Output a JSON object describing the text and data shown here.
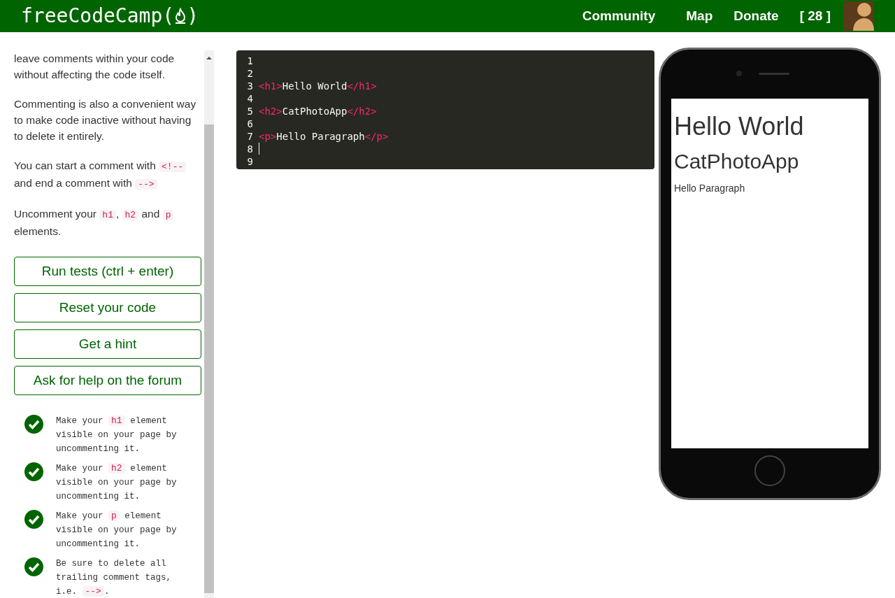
{
  "navbar": {
    "logo_text": "freeCodeCamp(",
    "logo_close": ")",
    "links": [
      "Community",
      "Map",
      "Donate"
    ],
    "points": "[ 28 ]"
  },
  "instructions": [
    [
      {
        "kind": "text",
        "text": "leave comments within your code without affecting the code itself."
      }
    ],
    [
      {
        "kind": "text",
        "text": "Commenting is also a convenient way to make code inactive without having to delete it entirely."
      }
    ],
    [
      {
        "kind": "text",
        "text": "You can start a comment with "
      },
      {
        "kind": "code",
        "text": "<!--"
      },
      {
        "kind": "text",
        "text": " and end a comment with "
      },
      {
        "kind": "code",
        "text": "-->"
      }
    ],
    [
      {
        "kind": "text",
        "text": "Uncomment your "
      },
      {
        "kind": "code",
        "text": "h1"
      },
      {
        "kind": "text",
        "text": ", "
      },
      {
        "kind": "code",
        "text": "h2"
      },
      {
        "kind": "text",
        "text": " and "
      },
      {
        "kind": "code",
        "text": "p"
      },
      {
        "kind": "text",
        "text": " elements."
      }
    ]
  ],
  "buttons": [
    "Run tests (ctrl + enter)",
    "Reset your code",
    "Get a hint",
    "Ask for help on the forum"
  ],
  "tests": [
    {
      "passed": true,
      "segments": [
        {
          "kind": "text",
          "text": "Make your "
        },
        {
          "kind": "code",
          "text": "h1"
        },
        {
          "kind": "text",
          "text": " element visible on your page by uncommenting it."
        }
      ]
    },
    {
      "passed": true,
      "segments": [
        {
          "kind": "text",
          "text": "Make your "
        },
        {
          "kind": "code",
          "text": "h2"
        },
        {
          "kind": "text",
          "text": " element visible on your page by uncommenting it."
        }
      ]
    },
    {
      "passed": true,
      "segments": [
        {
          "kind": "text",
          "text": "Make your "
        },
        {
          "kind": "code",
          "text": "p"
        },
        {
          "kind": "text",
          "text": " element visible on your page by uncommenting it."
        }
      ]
    },
    {
      "passed": true,
      "segments": [
        {
          "kind": "text",
          "text": "Be sure to delete all trailing comment tags, i.e. "
        },
        {
          "kind": "code",
          "text": "-->"
        },
        {
          "kind": "text",
          "text": "."
        }
      ]
    }
  ],
  "editor": {
    "lines": [
      {
        "number": "1",
        "cursor": false
      },
      {
        "number": "2",
        "cursor": false
      },
      {
        "number": "3",
        "cursor": false,
        "tokens": [
          {
            "kind": "tag",
            "text": "<h1>"
          },
          {
            "kind": "text",
            "text": "Hello World"
          },
          {
            "kind": "tag",
            "text": "</h1>"
          }
        ]
      },
      {
        "number": "4",
        "cursor": false
      },
      {
        "number": "5",
        "cursor": false,
        "tokens": [
          {
            "kind": "tag",
            "text": "<h2>"
          },
          {
            "kind": "text",
            "text": "CatPhotoApp"
          },
          {
            "kind": "tag",
            "text": "</h2>"
          }
        ]
      },
      {
        "number": "6",
        "cursor": false
      },
      {
        "number": "7",
        "cursor": false,
        "tokens": [
          {
            "kind": "tag",
            "text": "<p>"
          },
          {
            "kind": "text",
            "text": "Hello Paragraph"
          },
          {
            "kind": "tag",
            "text": "</p>"
          }
        ]
      },
      {
        "number": "8",
        "cursor": true
      },
      {
        "number": "9",
        "cursor": false
      }
    ]
  },
  "preview": [
    {
      "kind": "h1",
      "text": "Hello World"
    },
    {
      "kind": "h2",
      "text": "CatPhotoApp"
    },
    {
      "kind": "p",
      "text": "Hello Paragraph"
    }
  ]
}
